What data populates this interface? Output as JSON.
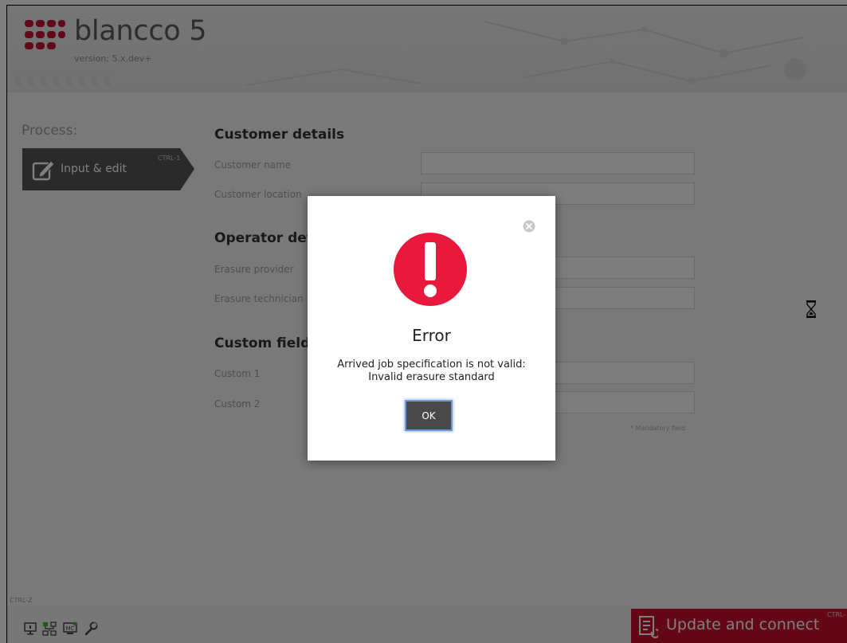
{
  "app": {
    "brand": "blancco 5",
    "version": "version: 5.x.dev+"
  },
  "sidebar": {
    "process_label": "Process:",
    "steps": [
      {
        "label": "Input & edit",
        "shortcut": "CTRL-1",
        "icon": "pencil-icon"
      }
    ]
  },
  "form": {
    "sections": [
      {
        "title": "Customer details",
        "fields": [
          {
            "label": "Customer name"
          },
          {
            "label": "Customer location"
          }
        ]
      },
      {
        "title": "Operator details",
        "fields": [
          {
            "label": "Erasure provider"
          },
          {
            "label": "Erasure technician"
          }
        ]
      },
      {
        "title": "Custom fields",
        "fields": [
          {
            "label": "Custom 1"
          },
          {
            "label": "Custom 2"
          }
        ]
      }
    ],
    "mandatory_note": "* Mandatory field"
  },
  "footer": {
    "undo_shortcut": "CTRL-Z",
    "icons": [
      "computer-icon",
      "network-icon",
      "mc-icon",
      "wrench-icon"
    ],
    "update_button": {
      "label": "Update and connect",
      "shortcut": "CTRL-"
    }
  },
  "dialog": {
    "title": "Error",
    "message_line1": "Arrived job specification is not valid:",
    "message_line2": "Invalid erasure standard",
    "ok_label": "OK",
    "icon": "error-exclamation-icon"
  },
  "colors": {
    "accent_red": "#c8102e",
    "error_red": "#e8193c",
    "step_bg": "#555555"
  }
}
